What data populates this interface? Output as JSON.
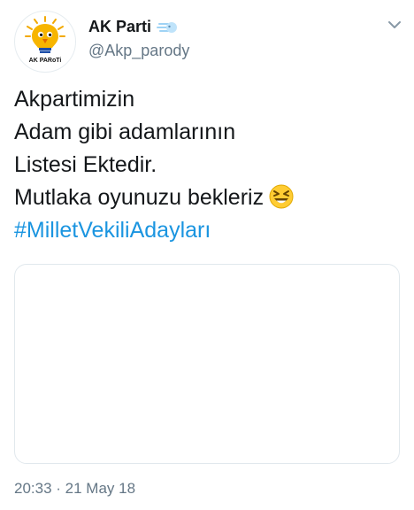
{
  "author": {
    "display_name": "AK Parti",
    "handle": "@Akp_parody",
    "avatar_caption": "AK PARoTi",
    "name_badge_icon": "wind-face-icon"
  },
  "tweet": {
    "lines": [
      "Akpartimizin",
      "Adam gibi adamlarının",
      "Listesi Ektedir.",
      "Mutlaka oyunuzu bekleriz"
    ],
    "emoji": "laughing-face-emoji",
    "hashtag": "#MilletVekiliAdayları",
    "timestamp": "20:33 · 21 May 18"
  },
  "colors": {
    "link": "#1b95e0",
    "secondary_text": "#657786",
    "primary_text": "#14171a",
    "border": "#e1e8ed"
  }
}
